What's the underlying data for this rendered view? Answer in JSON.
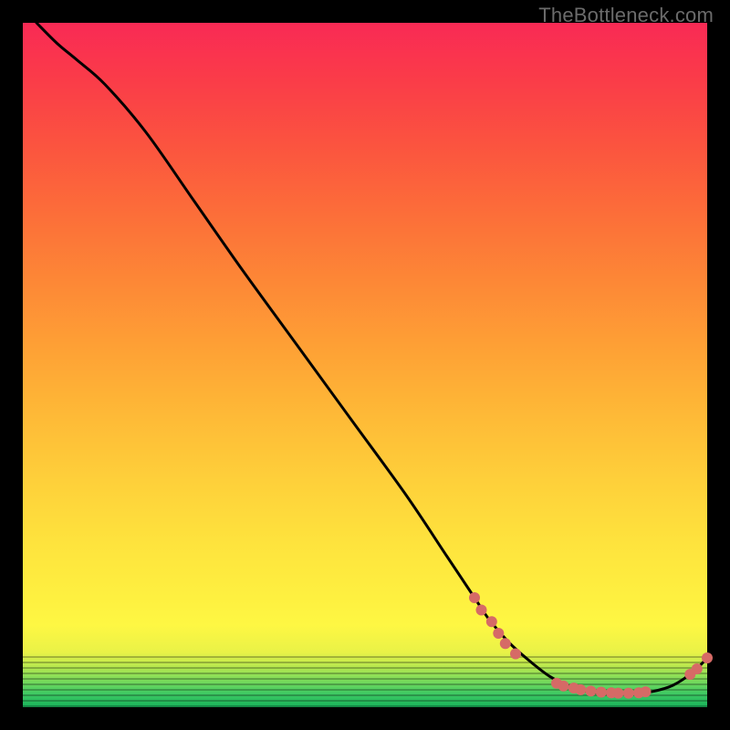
{
  "watermark": "TheBottleneck.com",
  "chart_data": {
    "type": "line",
    "title": "",
    "xlabel": "",
    "ylabel": "",
    "xlim": [
      0,
      100
    ],
    "ylim": [
      0,
      100
    ],
    "series": [
      {
        "name": "bottleneck-curve",
        "x": [
          2,
          5,
          8,
          12,
          18,
          25,
          32,
          40,
          48,
          56,
          62,
          66,
          68,
          71,
          74,
          77,
          80,
          83,
          86,
          89,
          92,
          95,
          98,
          100
        ],
        "y": [
          100,
          97,
          94.5,
          91,
          84,
          74,
          64,
          53,
          42,
          31,
          22,
          16,
          13,
          9.5,
          6.8,
          4.5,
          3,
          2.2,
          2,
          2,
          2.3,
          3.2,
          5.2,
          7.2
        ]
      }
    ],
    "markers": [
      {
        "x": 66.0,
        "y": 16.0
      },
      {
        "x": 67.0,
        "y": 14.2
      },
      {
        "x": 68.5,
        "y": 12.5
      },
      {
        "x": 69.5,
        "y": 10.8
      },
      {
        "x": 70.5,
        "y": 9.3
      },
      {
        "x": 72.0,
        "y": 7.8
      },
      {
        "x": 78.0,
        "y": 3.5
      },
      {
        "x": 79.0,
        "y": 3.1
      },
      {
        "x": 80.5,
        "y": 2.8
      },
      {
        "x": 81.5,
        "y": 2.55
      },
      {
        "x": 83.0,
        "y": 2.35
      },
      {
        "x": 84.5,
        "y": 2.2
      },
      {
        "x": 86.0,
        "y": 2.1
      },
      {
        "x": 87.0,
        "y": 2.05
      },
      {
        "x": 88.5,
        "y": 2.05
      },
      {
        "x": 90.0,
        "y": 2.1
      },
      {
        "x": 91.0,
        "y": 2.25
      },
      {
        "x": 97.5,
        "y": 4.8
      },
      {
        "x": 98.5,
        "y": 5.6
      },
      {
        "x": 100.0,
        "y": 7.2
      }
    ],
    "marker_color": "#d66a66",
    "curve_color": "#000000"
  }
}
